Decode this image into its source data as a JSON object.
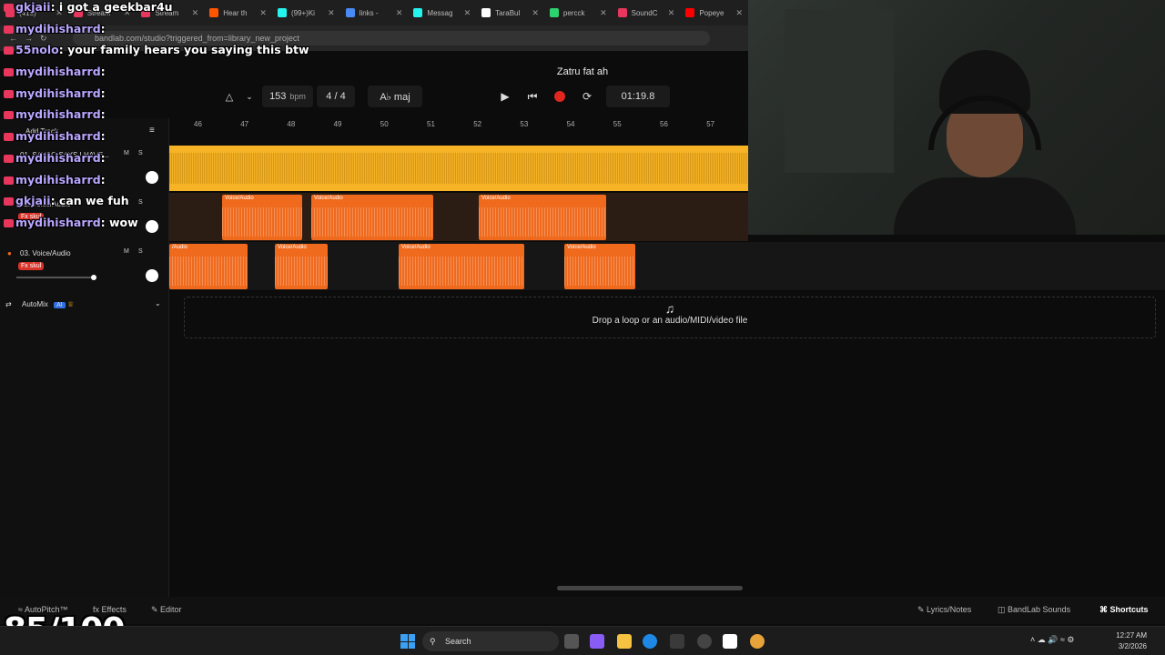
{
  "browser": {
    "tabs": [
      {
        "label": "(415)",
        "color": "#e8365d"
      },
      {
        "label": "Stream",
        "color": "#e8365d"
      },
      {
        "label": "Stream",
        "color": "#e8365d"
      },
      {
        "label": "Hear th",
        "color": "#ff5500"
      },
      {
        "label": "(99+)Ki",
        "color": "#25f4ee"
      },
      {
        "label": "links -",
        "color": "#4a8af4"
      },
      {
        "label": "Messag",
        "color": "#25f4ee"
      },
      {
        "label": "TaraBul",
        "color": "#ffffff"
      },
      {
        "label": "percck",
        "color": "#2dd36f"
      },
      {
        "label": "SoundC",
        "color": "#e8365d"
      },
      {
        "label": "Popeye",
        "color": "#ff0000"
      }
    ],
    "url": "bandlab.com/studio?triggered_from=library_new_project"
  },
  "studio": {
    "project_title": "Zatru fat ah",
    "bpm": "153",
    "bpm_unit": "bpm",
    "time_signature": "4 / 4",
    "key": "A♭ maj",
    "time": "01:19.8",
    "add_track": "Add Track",
    "ruler": [
      "46",
      "47",
      "48",
      "49",
      "50",
      "51",
      "52",
      "53",
      "54",
      "55",
      "56",
      "57"
    ],
    "tracks": [
      {
        "name": "01. SAYSO SAYS I HAVE...",
        "fx": ""
      },
      {
        "name": "02. Voice/Audio",
        "fx": "Fx skul"
      },
      {
        "name": "03. Voice/Audio",
        "fx": "Fx skul"
      }
    ],
    "mute": "M",
    "solo": "S",
    "clip_label": "Voice/Audio",
    "clip_label_short": "/Audio",
    "automix": "AutoMix",
    "ai_badge": "AI",
    "drop_text": "Drop a loop or an audio/MIDI/video file",
    "bottom": {
      "autopitch": "AutoPitch™",
      "effects": "Effects",
      "editor": "Editor",
      "lyrics": "Lyrics/Notes",
      "sounds": "BandLab Sounds",
      "shortcuts": "Shortcuts"
    }
  },
  "chat": [
    {
      "user": "gkjaii",
      "msg": ":  i got a geekbar4u"
    },
    {
      "user": "mydihisharrd",
      "msg": ":"
    },
    {
      "user": "55nolo",
      "msg": ":  your family hears you saying this btw"
    },
    {
      "user": "mydihisharrd",
      "msg": ":"
    },
    {
      "user": "mydihisharrd",
      "msg": ":"
    },
    {
      "user": "mydihisharrd",
      "msg": ":"
    },
    {
      "user": "mydihisharrd",
      "msg": ":"
    },
    {
      "user": "mydihisharrd",
      "msg": ":"
    },
    {
      "user": "mydihisharrd",
      "msg": ":"
    },
    {
      "user": "gkjaii",
      "msg": ":  can we fuh"
    },
    {
      "user": "mydihisharrd",
      "msg": ":  wow"
    }
  ],
  "score": "85/100",
  "taskbar": {
    "search": "Search",
    "time": "12:27 AM",
    "date": "3/2/2026"
  },
  "colors": {
    "accent_orange": "#f06a1d",
    "accent_yellow": "#f5b325",
    "record_red": "#e0261d",
    "chat_user": "#b9a6ff"
  }
}
